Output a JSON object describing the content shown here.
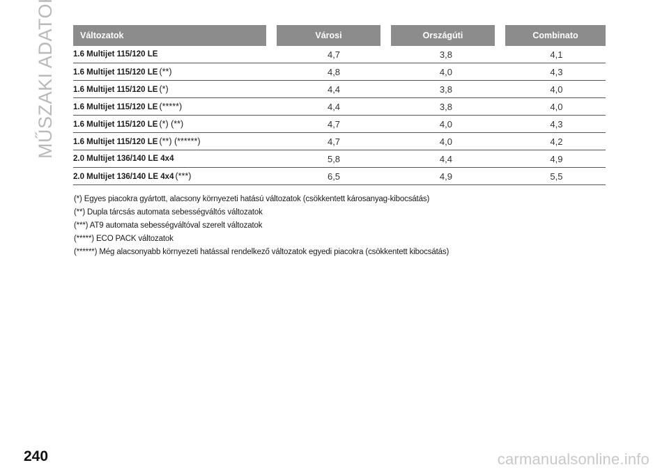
{
  "side_title": "MŰSZAKI ADATOK",
  "page_number": "240",
  "watermark": "carmanualsonline.info",
  "table": {
    "headers": [
      "Változatok",
      "Városi",
      "Országúti",
      "Combinato"
    ],
    "rows": [
      {
        "model": "1.6 Multijet 115/120 LE",
        "note": "",
        "values": [
          "4,7",
          "3,8",
          "4,1"
        ]
      },
      {
        "model": "1.6 Multijet 115/120 LE",
        "note": "(**)",
        "values": [
          "4,8",
          "4,0",
          "4,3"
        ]
      },
      {
        "model": "1.6 Multijet 115/120 LE",
        "note": "(*)",
        "values": [
          "4,4",
          "3,8",
          "4,0"
        ]
      },
      {
        "model": "1.6 Multijet 115/120 LE",
        "note": "(*****)",
        "values": [
          "4,4",
          "3,8",
          "4,0"
        ]
      },
      {
        "model": "1.6 Multijet 115/120 LE",
        "note": "(*) (**)",
        "values": [
          "4,7",
          "4,0",
          "4,3"
        ]
      },
      {
        "model": "1.6 Multijet 115/120 LE",
        "note": "(**) (******)",
        "values": [
          "4,7",
          "4,0",
          "4,2"
        ]
      },
      {
        "model": "2.0 Multijet 136/140 LE 4x4",
        "note": "",
        "values": [
          "5,8",
          "4,4",
          "4,9"
        ]
      },
      {
        "model": "2.0 Multijet 136/140 LE 4x4",
        "note": "(***)",
        "values": [
          "6,5",
          "4,9",
          "5,5"
        ]
      }
    ]
  },
  "footnotes": [
    "(*) Egyes piacokra gyártott, alacsony környezeti hatású változatok (csökkentett károsanyag-kibocsátás)",
    "(**) Dupla tárcsás automata sebességváltós változatok",
    "(***) AT9 automata sebességváltóval szerelt változatok",
    "(*****) ECO PACK változatok",
    "(******) Még alacsonyabb környezeti hatással rendelkező változatok egyedi piacokra (csökkentett kibocsátás)"
  ]
}
